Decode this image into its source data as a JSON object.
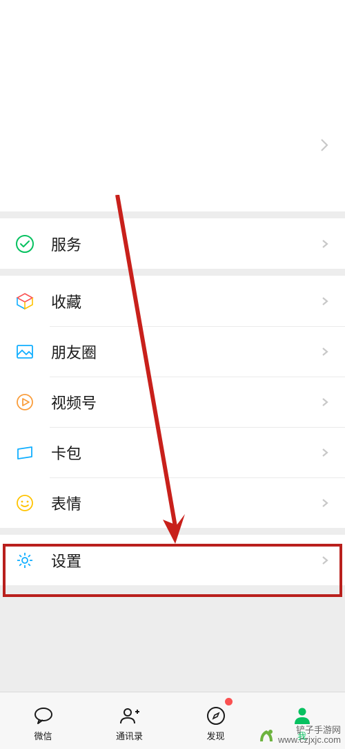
{
  "menu": {
    "services": "服务",
    "favorites": "收藏",
    "moments": "朋友圈",
    "channels": "视频号",
    "cards": "卡包",
    "stickers": "表情",
    "settings": "设置"
  },
  "tabs": {
    "chats": "微信",
    "contacts": "通讯录",
    "discover": "发现",
    "me": "我"
  },
  "watermark": {
    "name": "铲子手游网",
    "url": "www.czjxjc.com"
  },
  "colors": {
    "accent": "#07c160",
    "highlight": "#b9201d"
  }
}
